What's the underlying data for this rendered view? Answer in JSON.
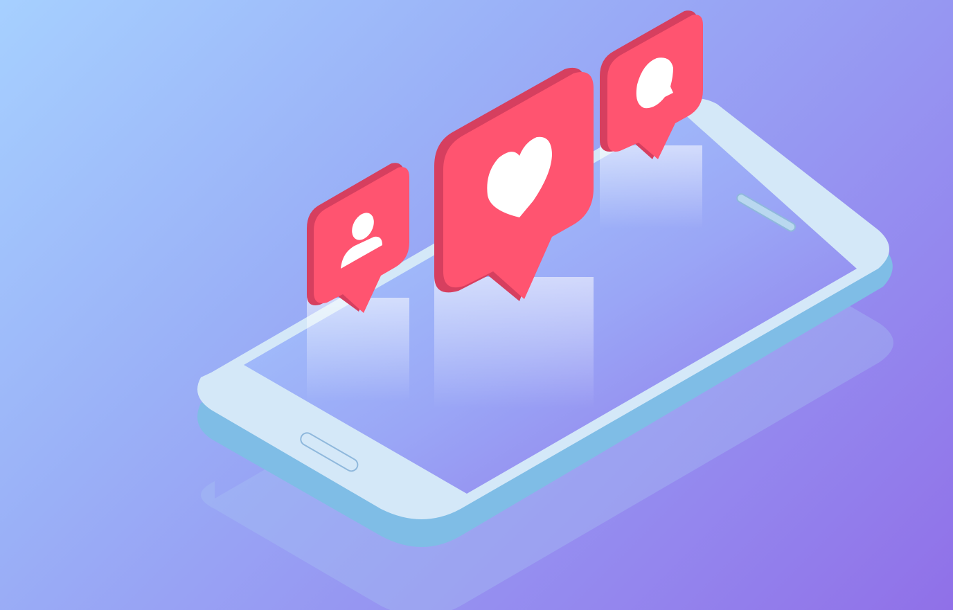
{
  "palette": {
    "background_start": "#a6d0ff",
    "background_end": "#9070e8",
    "phone_body": "#d4e8f8",
    "phone_edge": "#7fbde6",
    "bubble_face": "#ff5470",
    "bubble_side": "#d63f5f",
    "icon_fill": "#ffffff"
  },
  "illustration": {
    "subject": "isometric-smartphone-with-notification-bubbles",
    "bubbles": [
      {
        "icon": "user-icon",
        "role": "follower-notification"
      },
      {
        "icon": "heart-icon",
        "role": "like-notification"
      },
      {
        "icon": "comment-icon",
        "role": "comment-notification"
      }
    ]
  }
}
